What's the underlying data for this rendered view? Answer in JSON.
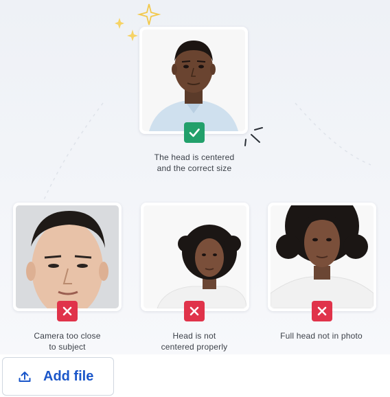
{
  "accent_color": "#1a56c9",
  "correct_color": "#22a06b",
  "incorrect_color": "#e0334a",
  "correct_example": {
    "status_icon": "check-icon",
    "caption_lines": [
      "The head is centered",
      "and the correct size"
    ]
  },
  "incorrect_examples": [
    {
      "status_icon": "x-icon",
      "caption_lines": [
        "Camera too close",
        "to subject"
      ]
    },
    {
      "status_icon": "x-icon",
      "caption_lines": [
        "Head is not",
        "centered properly"
      ]
    },
    {
      "status_icon": "x-icon",
      "caption_lines": [
        "Full head not in photo",
        ""
      ]
    }
  ],
  "add_file_button": {
    "icon": "upload-icon",
    "label": "Add file"
  }
}
